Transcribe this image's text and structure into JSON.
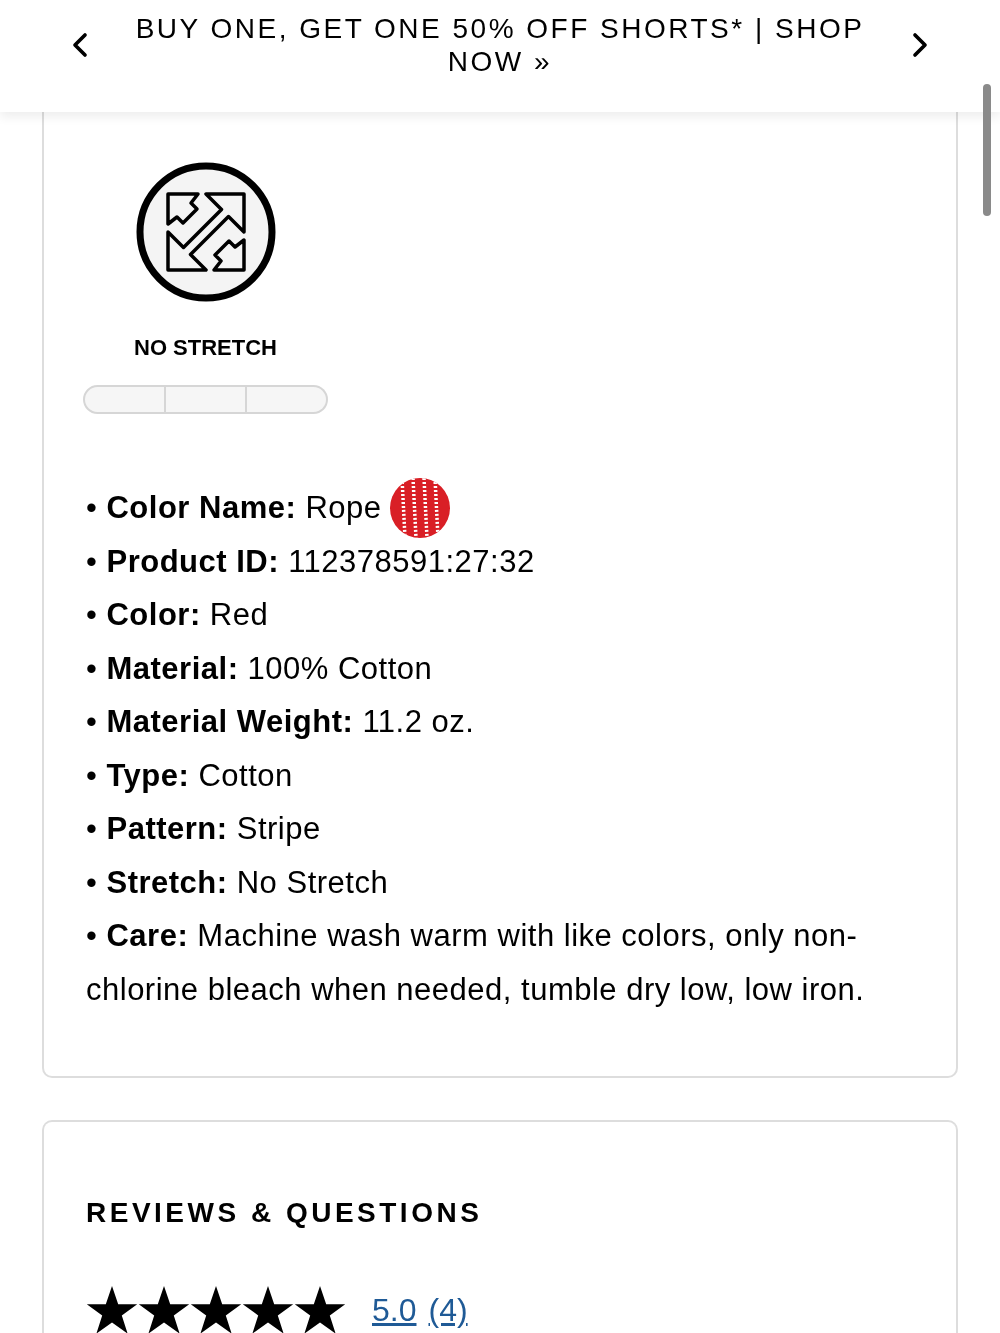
{
  "promo_bar": {
    "text": "BUY ONE, GET ONE 50% OFF SHORTS* | SHOP NOW »"
  },
  "details_card": {
    "stretch": {
      "label": "NO STRETCH",
      "segments": [
        {
          "filled": false
        },
        {
          "filled": false
        },
        {
          "filled": false
        }
      ]
    },
    "attributes": [
      {
        "kind": "swatch",
        "text": "• **Color Name:** Rope"
      },
      {
        "kind": "plain",
        "text": "• **Product ID:** 112378591:27:32"
      },
      {
        "kind": "plain",
        "text": "• **Color:** Red"
      },
      {
        "kind": "plain",
        "text": "• **Material:** 100% Cotton"
      },
      {
        "kind": "plain",
        "text": "• **Material Weight:** 11.2 oz."
      },
      {
        "kind": "plain",
        "text": "• **Type:** Cotton"
      },
      {
        "kind": "plain",
        "text": "• **Pattern:** Stripe"
      },
      {
        "kind": "plain",
        "text": "• **Stretch:** No Stretch"
      },
      {
        "kind": "plain",
        "text": "• **Care:** Machine wash warm with like colors, only non-chlorine bleach when needed, tumble dry low, low iron."
      }
    ]
  },
  "reviews_card": {
    "title": "REVIEWS & QUESTIONS",
    "stars": 5,
    "rating": "5.0",
    "count": "(4)"
  }
}
